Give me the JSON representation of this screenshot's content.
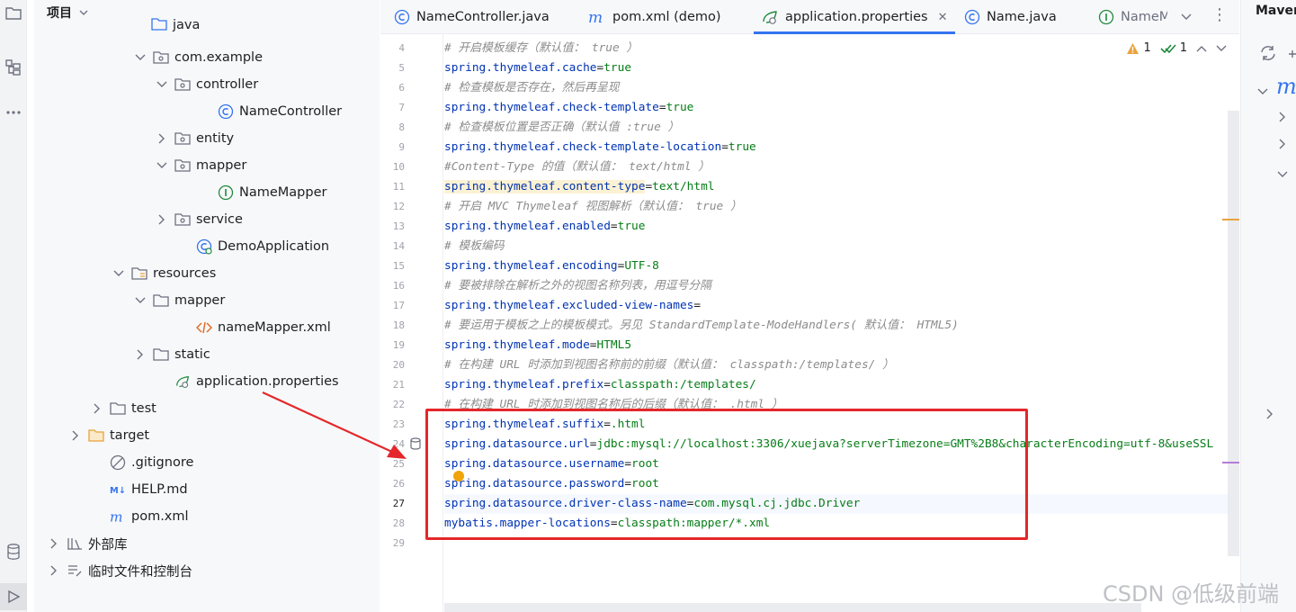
{
  "project": {
    "title": "项目",
    "tree": [
      {
        "label": "java",
        "icon": "source-folder-icon",
        "expanded": true
      },
      {
        "label": "com.example",
        "icon": "package-icon",
        "expanded": true
      },
      {
        "label": "controller",
        "icon": "package-icon",
        "expanded": true
      },
      {
        "label": "NameController",
        "icon": "class-icon"
      },
      {
        "label": "entity",
        "icon": "package-icon",
        "expanded": false
      },
      {
        "label": "mapper",
        "icon": "package-icon",
        "expanded": true
      },
      {
        "label": "NameMapper",
        "icon": "interface-icon"
      },
      {
        "label": "service",
        "icon": "package-icon",
        "expanded": false
      },
      {
        "label": "DemoApplication",
        "icon": "spring-boot-class-icon"
      },
      {
        "label": "resources",
        "icon": "resources-folder-icon",
        "expanded": true
      },
      {
        "label": "mapper",
        "icon": "folder-icon",
        "expanded": true
      },
      {
        "label": "nameMapper.xml",
        "icon": "xml-icon"
      },
      {
        "label": "static",
        "icon": "folder-icon",
        "expanded": false
      },
      {
        "label": "application.properties",
        "icon": "spring-properties-icon",
        "selected": true
      },
      {
        "label": "test",
        "icon": "folder-icon",
        "expanded": false
      },
      {
        "label": "target",
        "icon": "excluded-folder-icon",
        "expanded": false
      },
      {
        "label": ".gitignore",
        "icon": "ignore-file-icon"
      },
      {
        "label": "HELP.md",
        "icon": "markdown-icon"
      },
      {
        "label": "pom.xml",
        "icon": "maven-icon"
      },
      {
        "label": "外部库",
        "icon": "library-icon",
        "expanded": false
      },
      {
        "label": "临时文件和控制台",
        "icon": "scratches-icon",
        "expanded": false
      }
    ]
  },
  "tabs": [
    {
      "label": "NameController.java",
      "icon": "class-icon"
    },
    {
      "label": "pom.xml (demo)",
      "icon": "maven-icon"
    },
    {
      "label": "application.properties",
      "icon": "spring-properties-icon",
      "active": true
    },
    {
      "label": "Name.java",
      "icon": "class-icon"
    },
    {
      "label": "NameM",
      "icon": "interface-icon"
    }
  ],
  "inspections": {
    "warnings": "1",
    "ok": "1"
  },
  "editor": {
    "current_line": 27,
    "lines": [
      {
        "n": "4",
        "type": "comment",
        "text": "# 开启模板缓存（默认值： true ）"
      },
      {
        "n": "5",
        "type": "prop",
        "key": "spring.thymeleaf.cache",
        "value": "true"
      },
      {
        "n": "6",
        "type": "comment",
        "text": "# 检查模板是否存在，然后再呈现"
      },
      {
        "n": "7",
        "type": "prop",
        "key": "spring.thymeleaf.check-template",
        "value": "true"
      },
      {
        "n": "8",
        "type": "comment",
        "text": "# 检查模板位置是否正确（默认值 :true ）"
      },
      {
        "n": "9",
        "type": "prop",
        "key": "spring.thymeleaf.check-template-location",
        "value": "true"
      },
      {
        "n": "10",
        "type": "comment",
        "text": "#Content-Type 的值（默认值： text/html ）"
      },
      {
        "n": "11",
        "type": "prop",
        "key": "spring.thymeleaf.content-type",
        "value": "text/html",
        "highlight": true
      },
      {
        "n": "12",
        "type": "comment",
        "text": "# 开启 MVC Thymeleaf 视图解析（默认值： true ）"
      },
      {
        "n": "13",
        "type": "prop",
        "key": "spring.thymeleaf.enabled",
        "value": "true"
      },
      {
        "n": "14",
        "type": "comment",
        "text": "# 模板编码"
      },
      {
        "n": "15",
        "type": "prop",
        "key": "spring.thymeleaf.encoding",
        "value": "UTF-8"
      },
      {
        "n": "16",
        "type": "comment",
        "text": "# 要被排除在解析之外的视图名称列表，用逗号分隔"
      },
      {
        "n": "17",
        "type": "prop",
        "key": "spring.thymeleaf.excluded-view-names",
        "value": ""
      },
      {
        "n": "18",
        "type": "comment",
        "text": "# 要运用于模板之上的模板模式。另见 StandardTemplate-ModeHandlers( 默认值： HTML5)"
      },
      {
        "n": "19",
        "type": "prop",
        "key": "spring.thymeleaf.mode",
        "value": "HTML5"
      },
      {
        "n": "20",
        "type": "comment",
        "text": "# 在构建 URL 时添加到视图名称前的前缀（默认值： classpath:/templates/ ）"
      },
      {
        "n": "21",
        "type": "prop",
        "key": "spring.thymeleaf.prefix",
        "value": "classpath:/templates/"
      },
      {
        "n": "22",
        "type": "comment",
        "text": "# 在构建 URL 时添加到视图名称后的后缀（默认值： .html ）"
      },
      {
        "n": "23",
        "type": "prop",
        "key": "spring.thymeleaf.suffix",
        "value": ".html"
      },
      {
        "n": "24",
        "type": "prop",
        "key": "spring.datasource.url",
        "value": "jdbc:mysql://localhost:3306/xuejava?serverTimezone=GMT%2B8&characterEncoding=utf-8&useSSL"
      },
      {
        "n": "25",
        "type": "prop",
        "key": "spring.datasource.username",
        "value": "root"
      },
      {
        "n": "26",
        "type": "prop",
        "key": "spring.datasource.password",
        "value": "root"
      },
      {
        "n": "27",
        "type": "prop",
        "key": "spring.datasource.driver-class-name",
        "value": "com.mysql.cj.jdbc.Driver"
      },
      {
        "n": "28",
        "type": "prop",
        "key": "mybatis.mapper-locations",
        "value": "classpath:mapper/*.xml"
      },
      {
        "n": "29",
        "type": "empty",
        "text": ""
      }
    ]
  },
  "maven": {
    "title": "Maven",
    "root_label": "m"
  },
  "watermark": "CSDN @低级前端",
  "colors": {
    "accent": "#3574f0",
    "annotation_red": "#e4272a",
    "string": "#067d17",
    "key": "#1750eb",
    "comment": "#8c8c8c"
  }
}
